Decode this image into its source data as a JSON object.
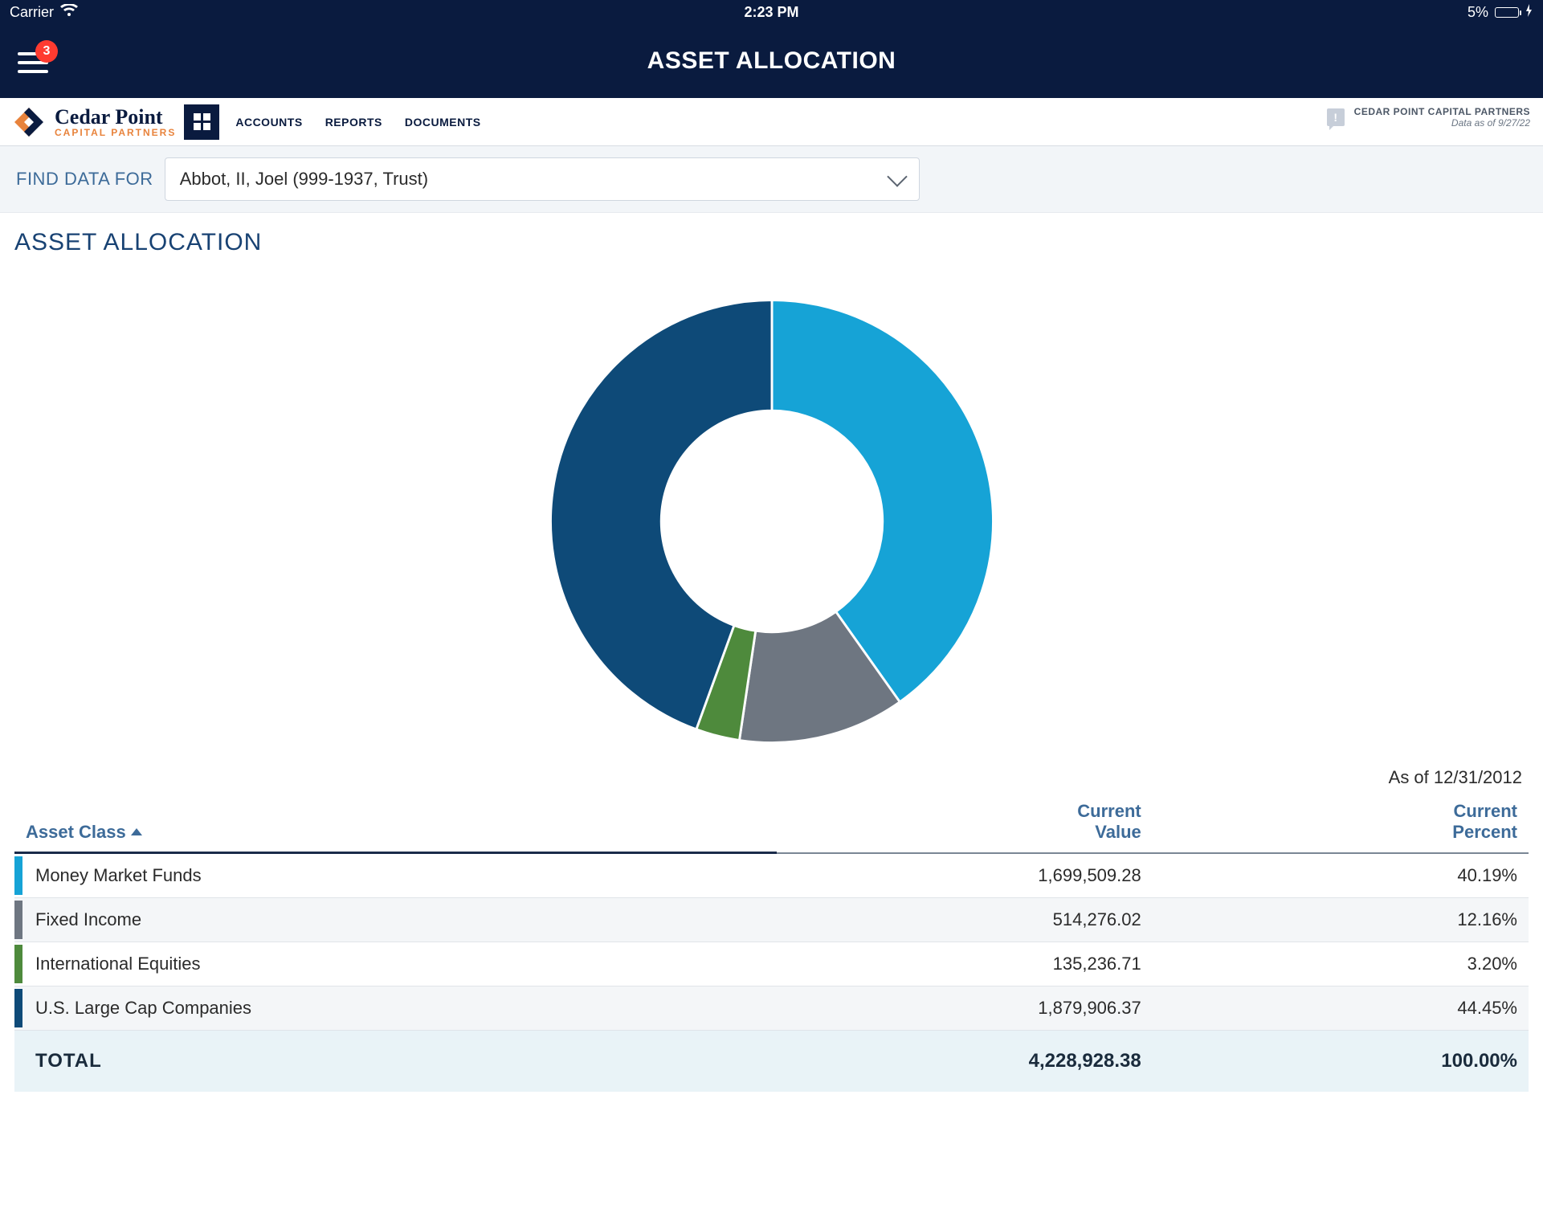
{
  "status": {
    "carrier": "Carrier",
    "time": "2:23 PM",
    "battery_text": "5%",
    "battery_level_pct": 5
  },
  "title_bar": {
    "title": "ASSET ALLOCATION",
    "badge": "3"
  },
  "top_nav": {
    "logo_line1": "Cedar Point",
    "logo_line2": "CAPITAL PARTNERS",
    "links": [
      "ACCOUNTS",
      "REPORTS",
      "DOCUMENTS"
    ],
    "firm_name": "CEDAR POINT CAPITAL PARTNERS",
    "data_as_of": "Data as of 9/27/22"
  },
  "finder": {
    "label": "FIND DATA FOR",
    "selected": "Abbot, II, Joel (999-1937, Trust)"
  },
  "page": {
    "heading": "ASSET ALLOCATION",
    "as_of_label": "As of 12/31/2012"
  },
  "table": {
    "header_asset_class": "Asset Class",
    "header_current_value_l1": "Current",
    "header_current_value_l2": "Value",
    "header_current_percent_l1": "Current",
    "header_current_percent_l2": "Percent",
    "rows": [
      {
        "name": "Money Market Funds",
        "value": "1,699,509.28",
        "percent": "40.19%",
        "color": "#16a3d6"
      },
      {
        "name": "Fixed Income",
        "value": "514,276.02",
        "percent": "12.16%",
        "color": "#6e7681"
      },
      {
        "name": "International Equities",
        "value": "135,236.71",
        "percent": "3.20%",
        "color": "#4e8a3c"
      },
      {
        "name": "U.S. Large Cap Companies",
        "value": "1,879,906.37",
        "percent": "44.45%",
        "color": "#0e4a78"
      }
    ],
    "total_label": "TOTAL",
    "total_value": "4,228,928.38",
    "total_percent": "100.00%"
  },
  "chart_data": {
    "type": "pie",
    "title": "",
    "categories": [
      "Money Market Funds",
      "Fixed Income",
      "International Equities",
      "U.S. Large Cap Companies"
    ],
    "values": [
      40.19,
      12.16,
      3.2,
      44.45
    ],
    "colors": [
      "#16a3d6",
      "#6e7681",
      "#4e8a3c",
      "#0e4a78"
    ],
    "start_angle_deg": 0,
    "direction": "clockwise",
    "donut_inner_ratio": 0.5
  }
}
